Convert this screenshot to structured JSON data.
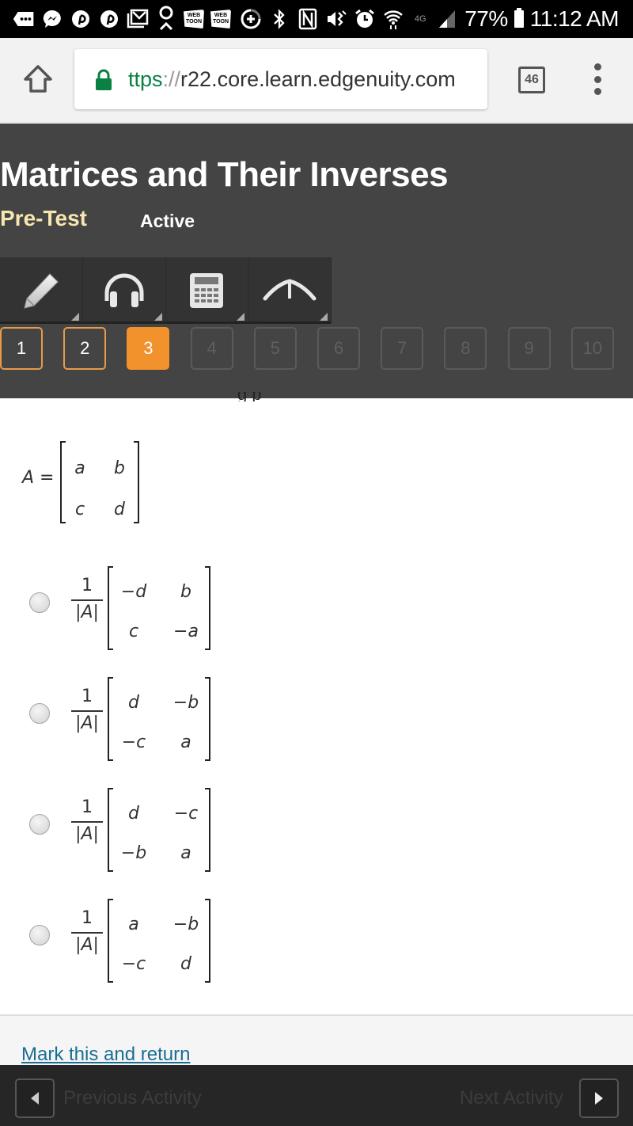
{
  "status_bar": {
    "left_icons": [
      "more-notifications-icon",
      "messenger-icon",
      "pinterest-icon",
      "pinterest-icon",
      "gmail-icon",
      "location-icon",
      "webtoon-icon",
      "webtoon-icon"
    ],
    "webtoon_label": "WEB TOON",
    "right_icons": [
      "data-saver-icon",
      "bluetooth-icon",
      "nfc-icon",
      "vibrate-icon",
      "alarm-icon",
      "wifi-icon",
      "lte-icon",
      "signal-icon"
    ],
    "lte_label": "4G",
    "battery": "77%",
    "time": "11:12 AM"
  },
  "browser": {
    "url_scheme": "ttps",
    "url_sep": "://",
    "url_host": "r22.core.learn.edgenuity.com",
    "tab_count": "46"
  },
  "header": {
    "title": "Matrices and Their Inverses",
    "subtitle": "Pre-Test",
    "status": "Active",
    "tools": [
      {
        "name": "pencil-icon"
      },
      {
        "name": "headphones-icon"
      },
      {
        "name": "calculator-icon"
      },
      {
        "name": "collapse-icon"
      }
    ],
    "questions": [
      {
        "label": "1",
        "state": "done"
      },
      {
        "label": "2",
        "state": "done"
      },
      {
        "label": "3",
        "state": "current"
      },
      {
        "label": "4",
        "state": "todo"
      },
      {
        "label": "5",
        "state": "todo"
      },
      {
        "label": "6",
        "state": "todo"
      },
      {
        "label": "7",
        "state": "todo"
      },
      {
        "label": "8",
        "state": "todo"
      },
      {
        "label": "9",
        "state": "todo"
      },
      {
        "label": "10",
        "state": "todo"
      }
    ],
    "accent_color": "#f2922c"
  },
  "question": {
    "partial_text": "g p",
    "matrix_label": "A =",
    "matrix": [
      [
        "a",
        "b"
      ],
      [
        "c",
        "d"
      ]
    ],
    "options": [
      {
        "numerator": "1",
        "denominator": "|A|",
        "matrix": [
          [
            "−d",
            "b"
          ],
          [
            "c",
            "−a"
          ]
        ]
      },
      {
        "numerator": "1",
        "denominator": "|A|",
        "matrix": [
          [
            "d",
            "−b"
          ],
          [
            "−c",
            "a"
          ]
        ]
      },
      {
        "numerator": "1",
        "denominator": "|A|",
        "matrix": [
          [
            "d",
            "−c"
          ],
          [
            "−b",
            "a"
          ]
        ]
      },
      {
        "numerator": "1",
        "denominator": "|A|",
        "matrix": [
          [
            "a",
            "−b"
          ],
          [
            "−c",
            "d"
          ]
        ]
      }
    ]
  },
  "footer": {
    "mark_link": "Mark this and return",
    "previous": "Previous Activity",
    "next": "Next Activity"
  }
}
